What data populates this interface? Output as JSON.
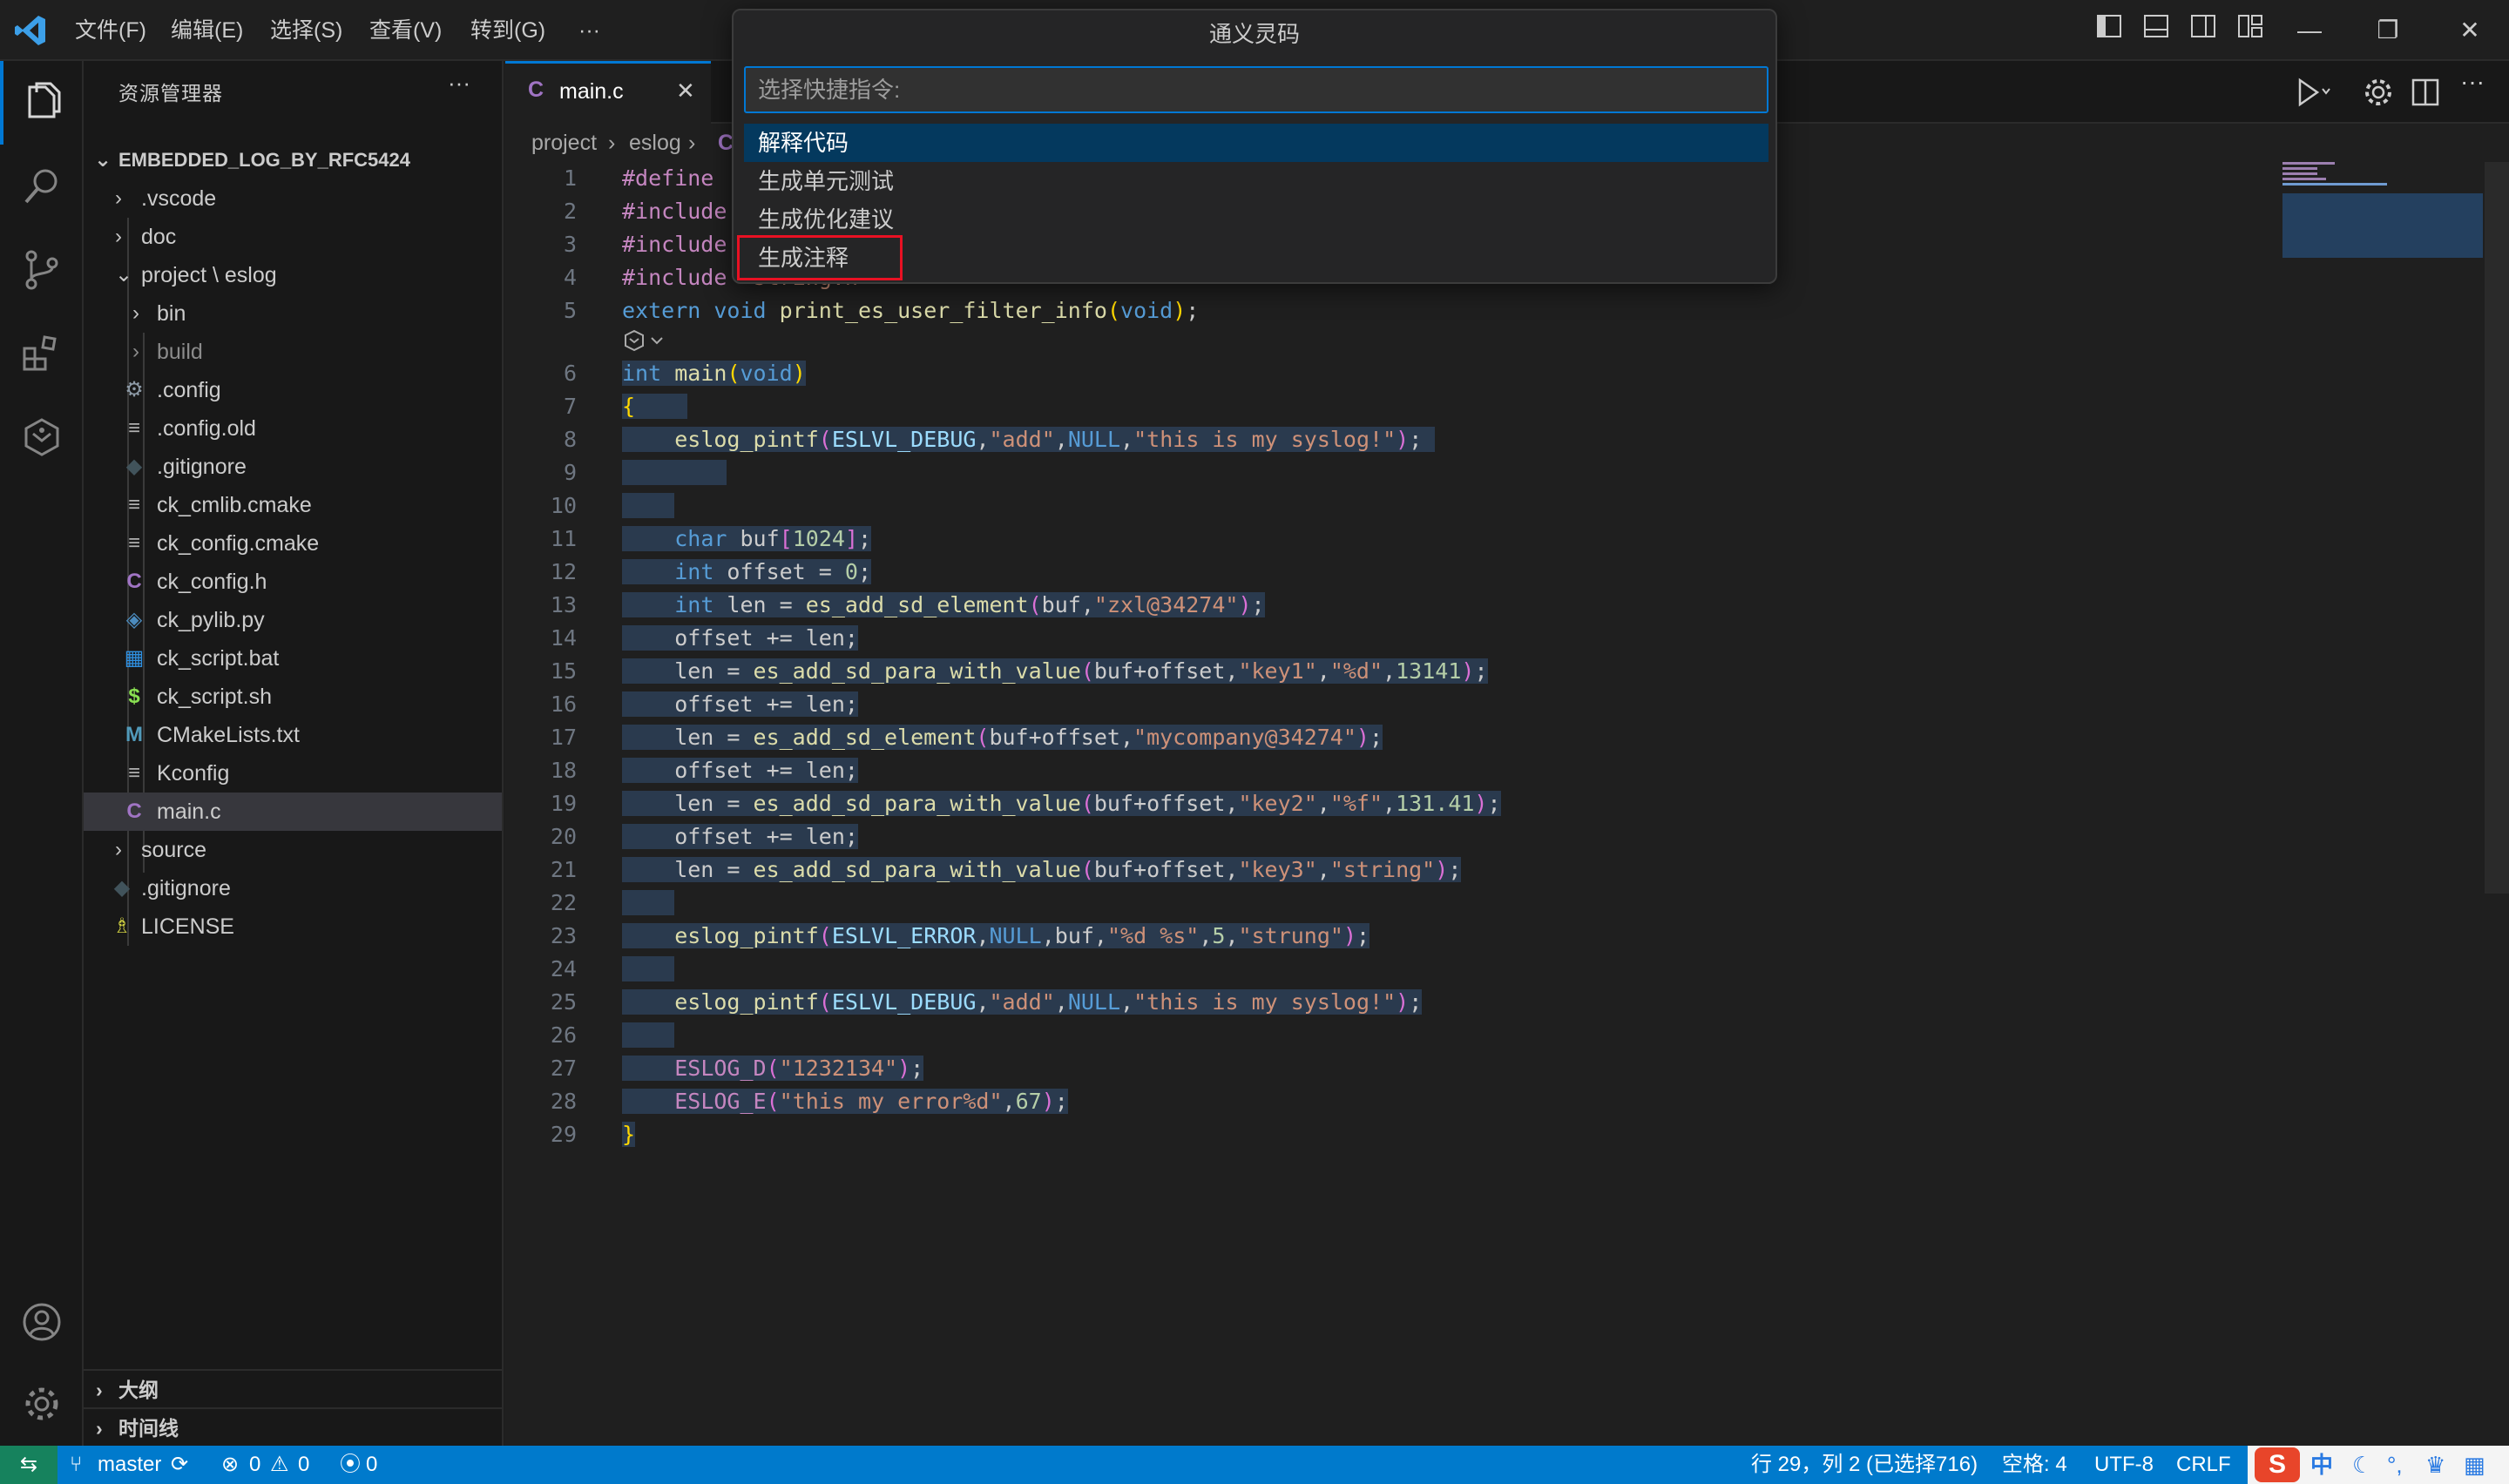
{
  "menu": [
    "文件(F)",
    "编辑(E)",
    "选择(S)",
    "查看(V)",
    "转到(G)",
    "···"
  ],
  "quickpick": {
    "title": "通义灵码",
    "placeholder": "选择快捷指令:",
    "items": [
      "解释代码",
      "生成单元测试",
      "生成优化建议",
      "生成注释"
    ]
  },
  "sidebar": {
    "title": "资源管理器",
    "more": "···",
    "root": "EMBEDDED_LOG_BY_RFC5424",
    "tree": [
      {
        "label": ".vscode",
        "type": "folder"
      },
      {
        "label": "doc",
        "type": "folder"
      },
      {
        "label": "project \\ eslog",
        "type": "folder-open"
      },
      {
        "label": "bin",
        "type": "folder"
      },
      {
        "label": "build",
        "type": "folder"
      },
      {
        "label": ".config",
        "type": "gear"
      },
      {
        "label": ".config.old",
        "type": "lines"
      },
      {
        "label": ".gitignore",
        "type": "diamond"
      },
      {
        "label": "ck_cmlib.cmake",
        "type": "lines"
      },
      {
        "label": "ck_config.cmake",
        "type": "lines"
      },
      {
        "label": "ck_config.h",
        "type": "c"
      },
      {
        "label": "ck_pylib.py",
        "type": "python"
      },
      {
        "label": "ck_script.bat",
        "type": "windows"
      },
      {
        "label": "ck_script.sh",
        "type": "dollar"
      },
      {
        "label": "CMakeLists.txt",
        "type": "m"
      },
      {
        "label": "Kconfig",
        "type": "lines"
      },
      {
        "label": "main.c",
        "type": "c"
      },
      {
        "label": "source",
        "type": "folder"
      },
      {
        "label": ".gitignore",
        "type": "diamond"
      },
      {
        "label": "LICENSE",
        "type": "license"
      }
    ],
    "outline": "大纲",
    "timeline": "时间线"
  },
  "tab": {
    "icon": "C",
    "label": "main.c",
    "close": "✕"
  },
  "breadcrumb": [
    "project",
    "eslog",
    "C"
  ],
  "statusbar": {
    "branch": "master",
    "errors": "0",
    "warnings": "0",
    "ports": "0",
    "position": "行 29，列 2 (已选择716)",
    "spaces": "空格: 4",
    "encoding": "UTF-8",
    "eol": "CRLF",
    "ime": "中"
  },
  "colors": {
    "accent": "#0078d4",
    "statusbar": "#007acc",
    "highlight": "#e81123"
  }
}
